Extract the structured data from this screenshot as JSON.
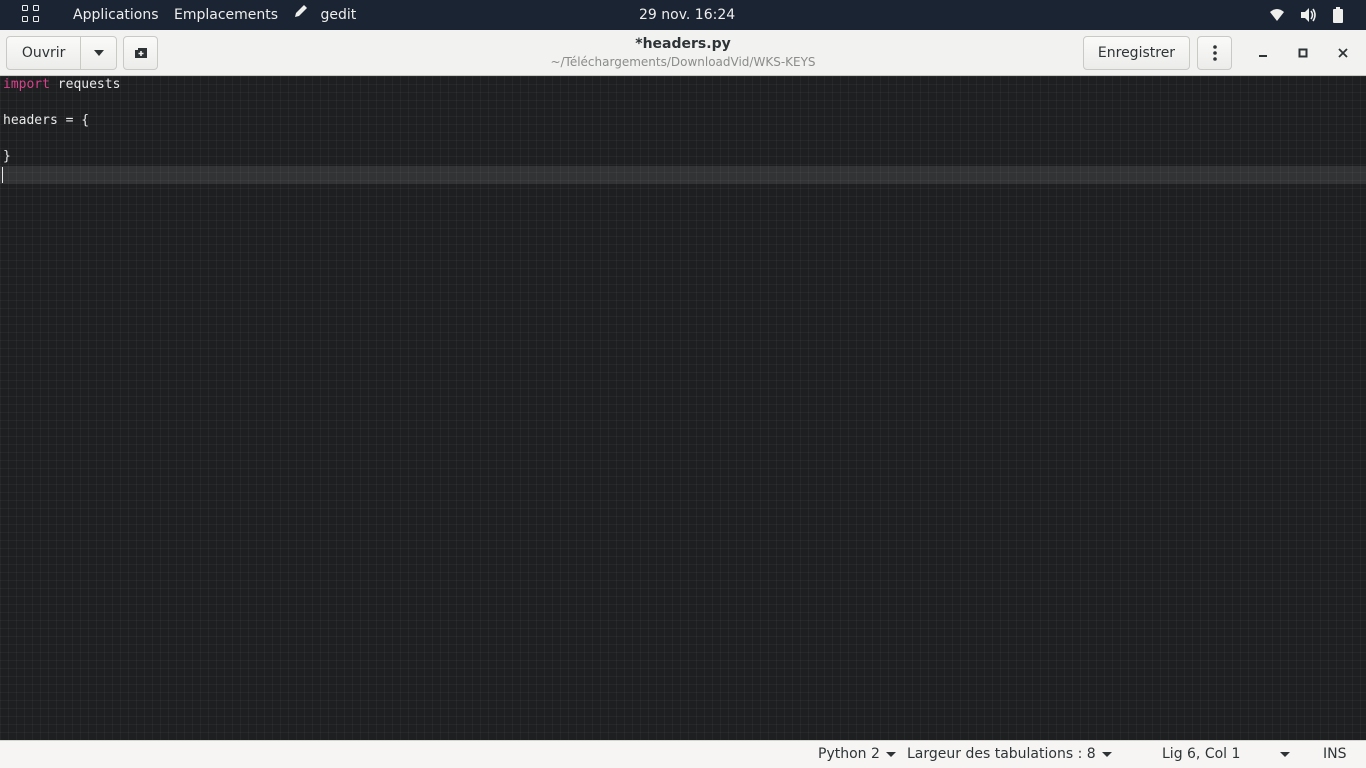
{
  "top_panel": {
    "applications_label": "Applications",
    "places_label": "Emplacements",
    "app_name": "gedit",
    "clock": "29 nov.  16:24",
    "tray_icons": [
      "wifi-icon",
      "volume-icon",
      "battery-icon"
    ]
  },
  "headerbar": {
    "open_label": "Ouvrir",
    "title": "*headers.py",
    "path": "~/Téléchargements/DownloadVid/WKS-KEYS",
    "save_label": "Enregistrer"
  },
  "editor": {
    "lines": [
      {
        "keyword": "import",
        "text": " requests"
      },
      {
        "keyword": "",
        "text": ""
      },
      {
        "keyword": "",
        "text": "headers = {"
      },
      {
        "keyword": "",
        "text": ""
      },
      {
        "keyword": "",
        "text": "}"
      },
      {
        "keyword": "",
        "text": ""
      }
    ],
    "colors": {
      "background": "#1d1f21",
      "keyword": "#d9418a",
      "text": "#eaeaea"
    }
  },
  "statusbar": {
    "language": "Python 2",
    "tab_width": "Largeur des tabulations : 8",
    "position": "Lig 6, Col 1",
    "mode": "INS"
  }
}
